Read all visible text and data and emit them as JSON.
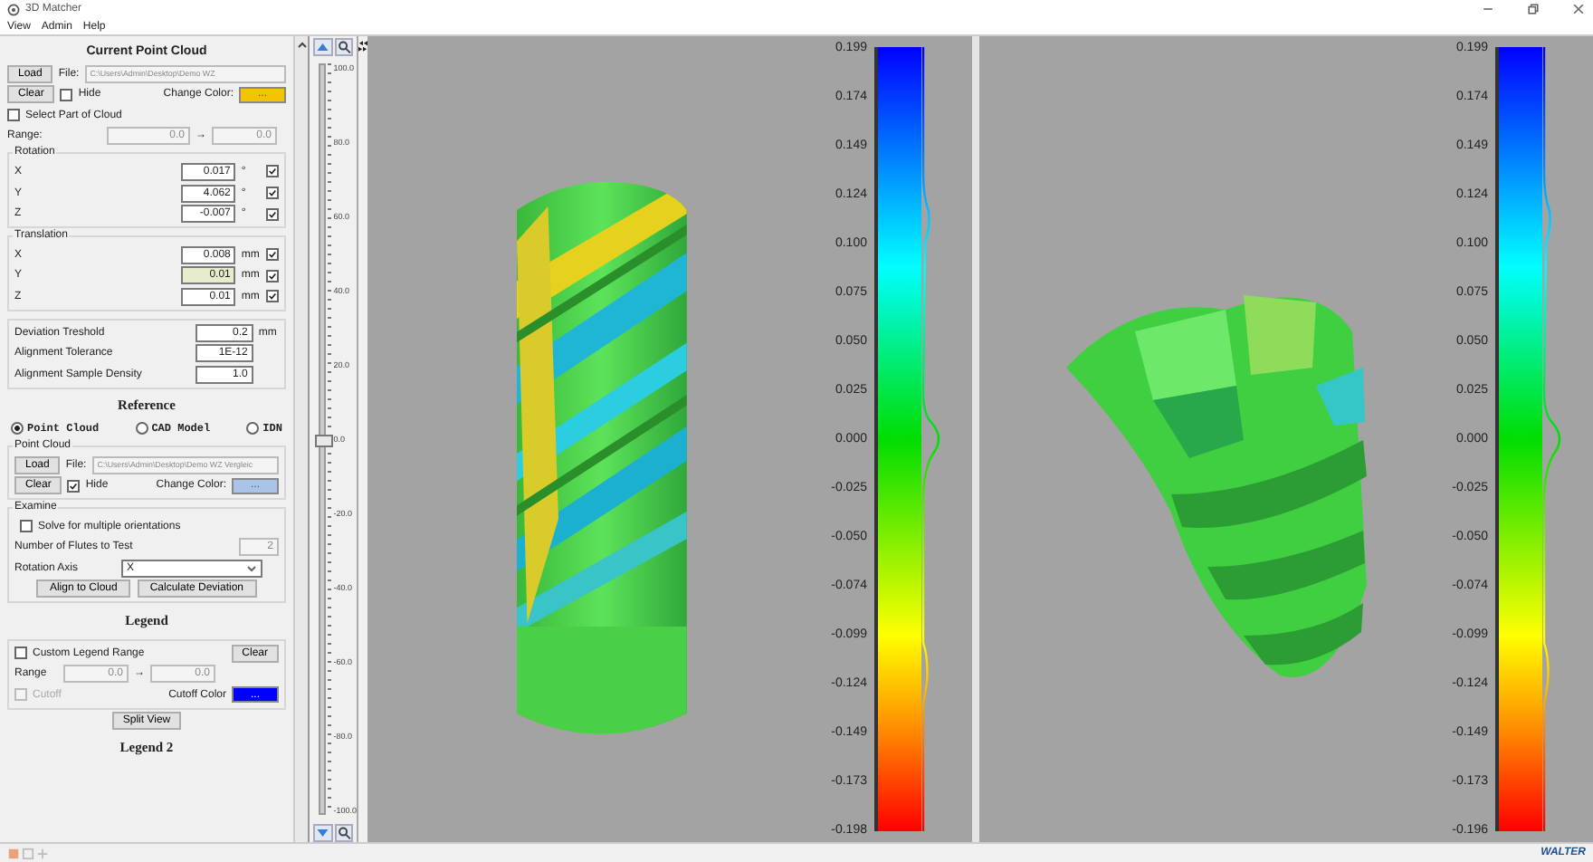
{
  "window": {
    "title": "3D Matcher"
  },
  "menu": [
    "View",
    "Admin",
    "Help"
  ],
  "current_cloud": {
    "title": "Current Point Cloud",
    "load": "Load",
    "file_label": "File:",
    "file": "C:\\Users\\Admin\\Desktop\\Demo WZ",
    "clear": "Clear",
    "hide": {
      "label": "Hide",
      "checked": false
    },
    "color_label": "Change Color:",
    "color": "#f5c400",
    "color_button": "...",
    "select_part": {
      "label": "Select Part of Cloud",
      "checked": false
    },
    "range": {
      "label": "Range:",
      "from": "0.0",
      "arrow": "→",
      "to": "0.0"
    }
  },
  "rotation": {
    "title": "Rotation",
    "rows": [
      {
        "axis": "X",
        "value": "0.017",
        "unit": "°",
        "checked": true,
        "highlighted": false
      },
      {
        "axis": "Y",
        "value": "4.062",
        "unit": "°",
        "checked": true,
        "highlighted": false
      },
      {
        "axis": "Z",
        "value": "-0.007",
        "unit": "°",
        "checked": true,
        "highlighted": false
      }
    ]
  },
  "translation": {
    "title": "Translation",
    "rows": [
      {
        "axis": "X",
        "value": "0.008",
        "unit": "mm",
        "checked": true,
        "highlighted": false
      },
      {
        "axis": "Y",
        "value": "0.01",
        "unit": "mm",
        "checked": true,
        "highlighted": true
      },
      {
        "axis": "Z",
        "value": "0.01",
        "unit": "mm",
        "checked": true,
        "highlighted": false
      }
    ]
  },
  "settings": [
    {
      "label": "Deviation Treshold",
      "value": "0.2",
      "unit": "mm"
    },
    {
      "label": "Alignment Tolerance",
      "value": "1E-12"
    },
    {
      "label": "Alignment Sample Density",
      "value": "1.0"
    }
  ],
  "reference": {
    "title": "Reference",
    "options": [
      {
        "label": "Point Cloud",
        "selected": true
      },
      {
        "label": "CAD Model",
        "selected": false
      },
      {
        "label": "IDN",
        "selected": false
      }
    ]
  },
  "reference_cloud": {
    "title": "Point Cloud",
    "load": "Load",
    "file_label": "File:",
    "file": "C:\\Users\\Admin\\Desktop\\Demo WZ Vergleic",
    "clear": "Clear",
    "hide": {
      "label": "Hide",
      "checked": true
    },
    "color_label": "Change Color:",
    "color": "#a9c4e8",
    "color_button": "..."
  },
  "examine": {
    "title": "Examine",
    "multiple": {
      "label": "Solve for multiple orientations",
      "checked": false
    },
    "flutes_label": "Number of Flutes to Test",
    "flutes": "2",
    "axis_label": "Rotation Axis",
    "axis": "X",
    "buttons": [
      "Align to Cloud",
      "Calculate Deviation"
    ]
  },
  "legend": {
    "title": "Legend",
    "custom": {
      "label": "Custom Legend Range",
      "checked": false
    },
    "clear": "Clear",
    "range": {
      "label": "Range",
      "from": "0.0",
      "arrow": "→",
      "to": "0.0"
    },
    "cutoff": {
      "label": "Cutoff",
      "checked": false,
      "disabled": true
    },
    "cutoff_color": {
      "label": "Cutoff Color",
      "color": "#0000ff",
      "button": "..."
    }
  },
  "split_view": "Split View",
  "legend2": {
    "title": "Legend 2"
  },
  "slider": {
    "labels": [
      "100.0",
      "80.0",
      "60.0",
      "40.0",
      "20.0",
      "0.0",
      "-20.0",
      "-40.0",
      "-60.0",
      "-80.0",
      "-100.0"
    ],
    "level": 0.5
  },
  "viewports": [
    {
      "kind": "drill",
      "ticks": [
        "0.199",
        "0.174",
        "0.149",
        "0.124",
        "0.100",
        "0.075",
        "0.050",
        "0.025",
        "0.000",
        "-0.025",
        "-0.050",
        "-0.074",
        "-0.099",
        "-0.124",
        "-0.149",
        "-0.173",
        "-0.198"
      ]
    },
    {
      "kind": "head",
      "ticks": [
        "0.199",
        "0.174",
        "0.149",
        "0.124",
        "0.100",
        "0.075",
        "0.050",
        "0.025",
        "0.000",
        "-0.025",
        "-0.050",
        "-0.074",
        "-0.099",
        "-0.124",
        "-0.149",
        "-0.173",
        "-0.196"
      ]
    }
  ],
  "status": {
    "logo": "WALTER"
  }
}
